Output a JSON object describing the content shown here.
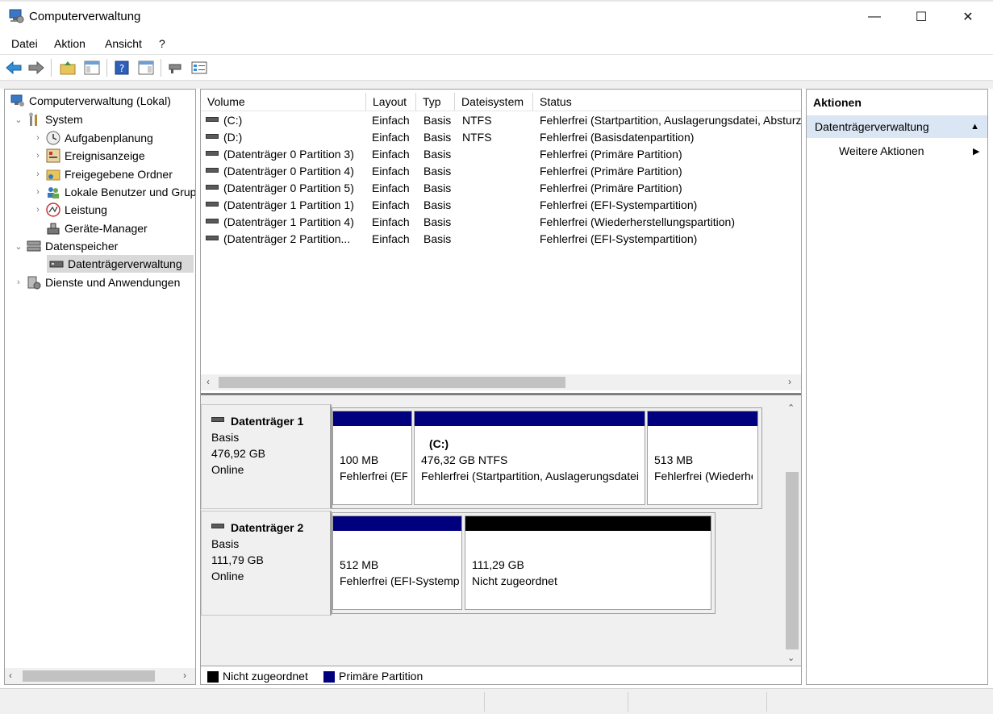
{
  "window": {
    "title": "Computerverwaltung",
    "minimize": "—",
    "maximize": "☐",
    "close": "✕"
  },
  "menu": {
    "items": [
      "Datei",
      "Aktion",
      "Ansicht",
      "?"
    ]
  },
  "tree": {
    "items": [
      {
        "label": "Computerverwaltung (Lokal)",
        "icon": "computer-management-icon"
      },
      {
        "label": "System",
        "icon": "tools-icon"
      },
      {
        "label": "Aufgabenplanung",
        "icon": "clock-icon"
      },
      {
        "label": "Ereignisanzeige",
        "icon": "event-viewer-icon"
      },
      {
        "label": "Freigegebene Ordner",
        "icon": "shared-folder-icon"
      },
      {
        "label": "Lokale Benutzer und Gruppen",
        "icon": "users-icon"
      },
      {
        "label": "Leistung",
        "icon": "performance-icon"
      },
      {
        "label": "Geräte-Manager",
        "icon": "device-manager-icon"
      },
      {
        "label": "Datenspeicher",
        "icon": "storage-icon"
      },
      {
        "label": "Datenträgerverwaltung",
        "icon": "disk-management-icon"
      },
      {
        "label": "Dienste und Anwendungen",
        "icon": "services-icon"
      }
    ]
  },
  "volumes": {
    "headers": [
      "Volume",
      "Layout",
      "Typ",
      "Dateisystem",
      "Status"
    ],
    "rows": [
      {
        "volume": "(C:)",
        "layout": "Einfach",
        "typ": "Basis",
        "fs": "NTFS",
        "status": "Fehlerfrei (Startpartition, Auslagerungsdatei, Absturzabbild, Primäre Partition)"
      },
      {
        "volume": "(D:)",
        "layout": "Einfach",
        "typ": "Basis",
        "fs": "NTFS",
        "status": "Fehlerfrei (Basisdatenpartition)"
      },
      {
        "volume": "(Datenträger 0 Partition 3)",
        "layout": "Einfach",
        "typ": "Basis",
        "fs": "",
        "status": "Fehlerfrei (Primäre Partition)"
      },
      {
        "volume": "(Datenträger 0 Partition 4)",
        "layout": "Einfach",
        "typ": "Basis",
        "fs": "",
        "status": "Fehlerfrei (Primäre Partition)"
      },
      {
        "volume": "(Datenträger 0 Partition 5)",
        "layout": "Einfach",
        "typ": "Basis",
        "fs": "",
        "status": "Fehlerfrei (Primäre Partition)"
      },
      {
        "volume": "(Datenträger 1 Partition 1)",
        "layout": "Einfach",
        "typ": "Basis",
        "fs": "",
        "status": "Fehlerfrei (EFI-Systempartition)"
      },
      {
        "volume": "(Datenträger 1 Partition 4)",
        "layout": "Einfach",
        "typ": "Basis",
        "fs": "",
        "status": "Fehlerfrei (Wiederherstellungspartition)"
      },
      {
        "volume": "(Datenträger 2 Partition...",
        "layout": "Einfach",
        "typ": "Basis",
        "fs": "",
        "status": "Fehlerfrei (EFI-Systempartition)"
      }
    ]
  },
  "disks": [
    {
      "name": "Datenträger 1",
      "type": "Basis",
      "size": "476,92 GB",
      "state": "Online",
      "partitions": [
        {
          "title": "",
          "size": "100 MB",
          "status": "Fehlerfrei (EFI-Systempartition)",
          "kind": "primary"
        },
        {
          "title": "(C:)",
          "size": "476,32 GB NTFS",
          "status": "Fehlerfrei (Startpartition, Auslagerungsdatei, Absturzabbild)",
          "kind": "primary"
        },
        {
          "title": "",
          "size": "513 MB",
          "status": "Fehlerfrei (Wiederherstellungspartition)",
          "kind": "primary"
        }
      ]
    },
    {
      "name": "Datenträger 2",
      "type": "Basis",
      "size": "111,79 GB",
      "state": "Online",
      "partitions": [
        {
          "title": "",
          "size": "512 MB",
          "status": "Fehlerfrei (EFI-Systempartition)",
          "kind": "primary"
        },
        {
          "title": "",
          "size": "111,29 GB",
          "status": "Nicht zugeordnet",
          "kind": "unallocated"
        }
      ]
    }
  ],
  "legend": {
    "unallocated": "Nicht zugeordnet",
    "primary": "Primäre Partition"
  },
  "colors": {
    "primary": "#00007e",
    "unallocated": "#000000",
    "section": "#dbe6f4"
  },
  "actions": {
    "header": "Aktionen",
    "section": "Datenträgerverwaltung",
    "item": "Weitere Aktionen"
  }
}
